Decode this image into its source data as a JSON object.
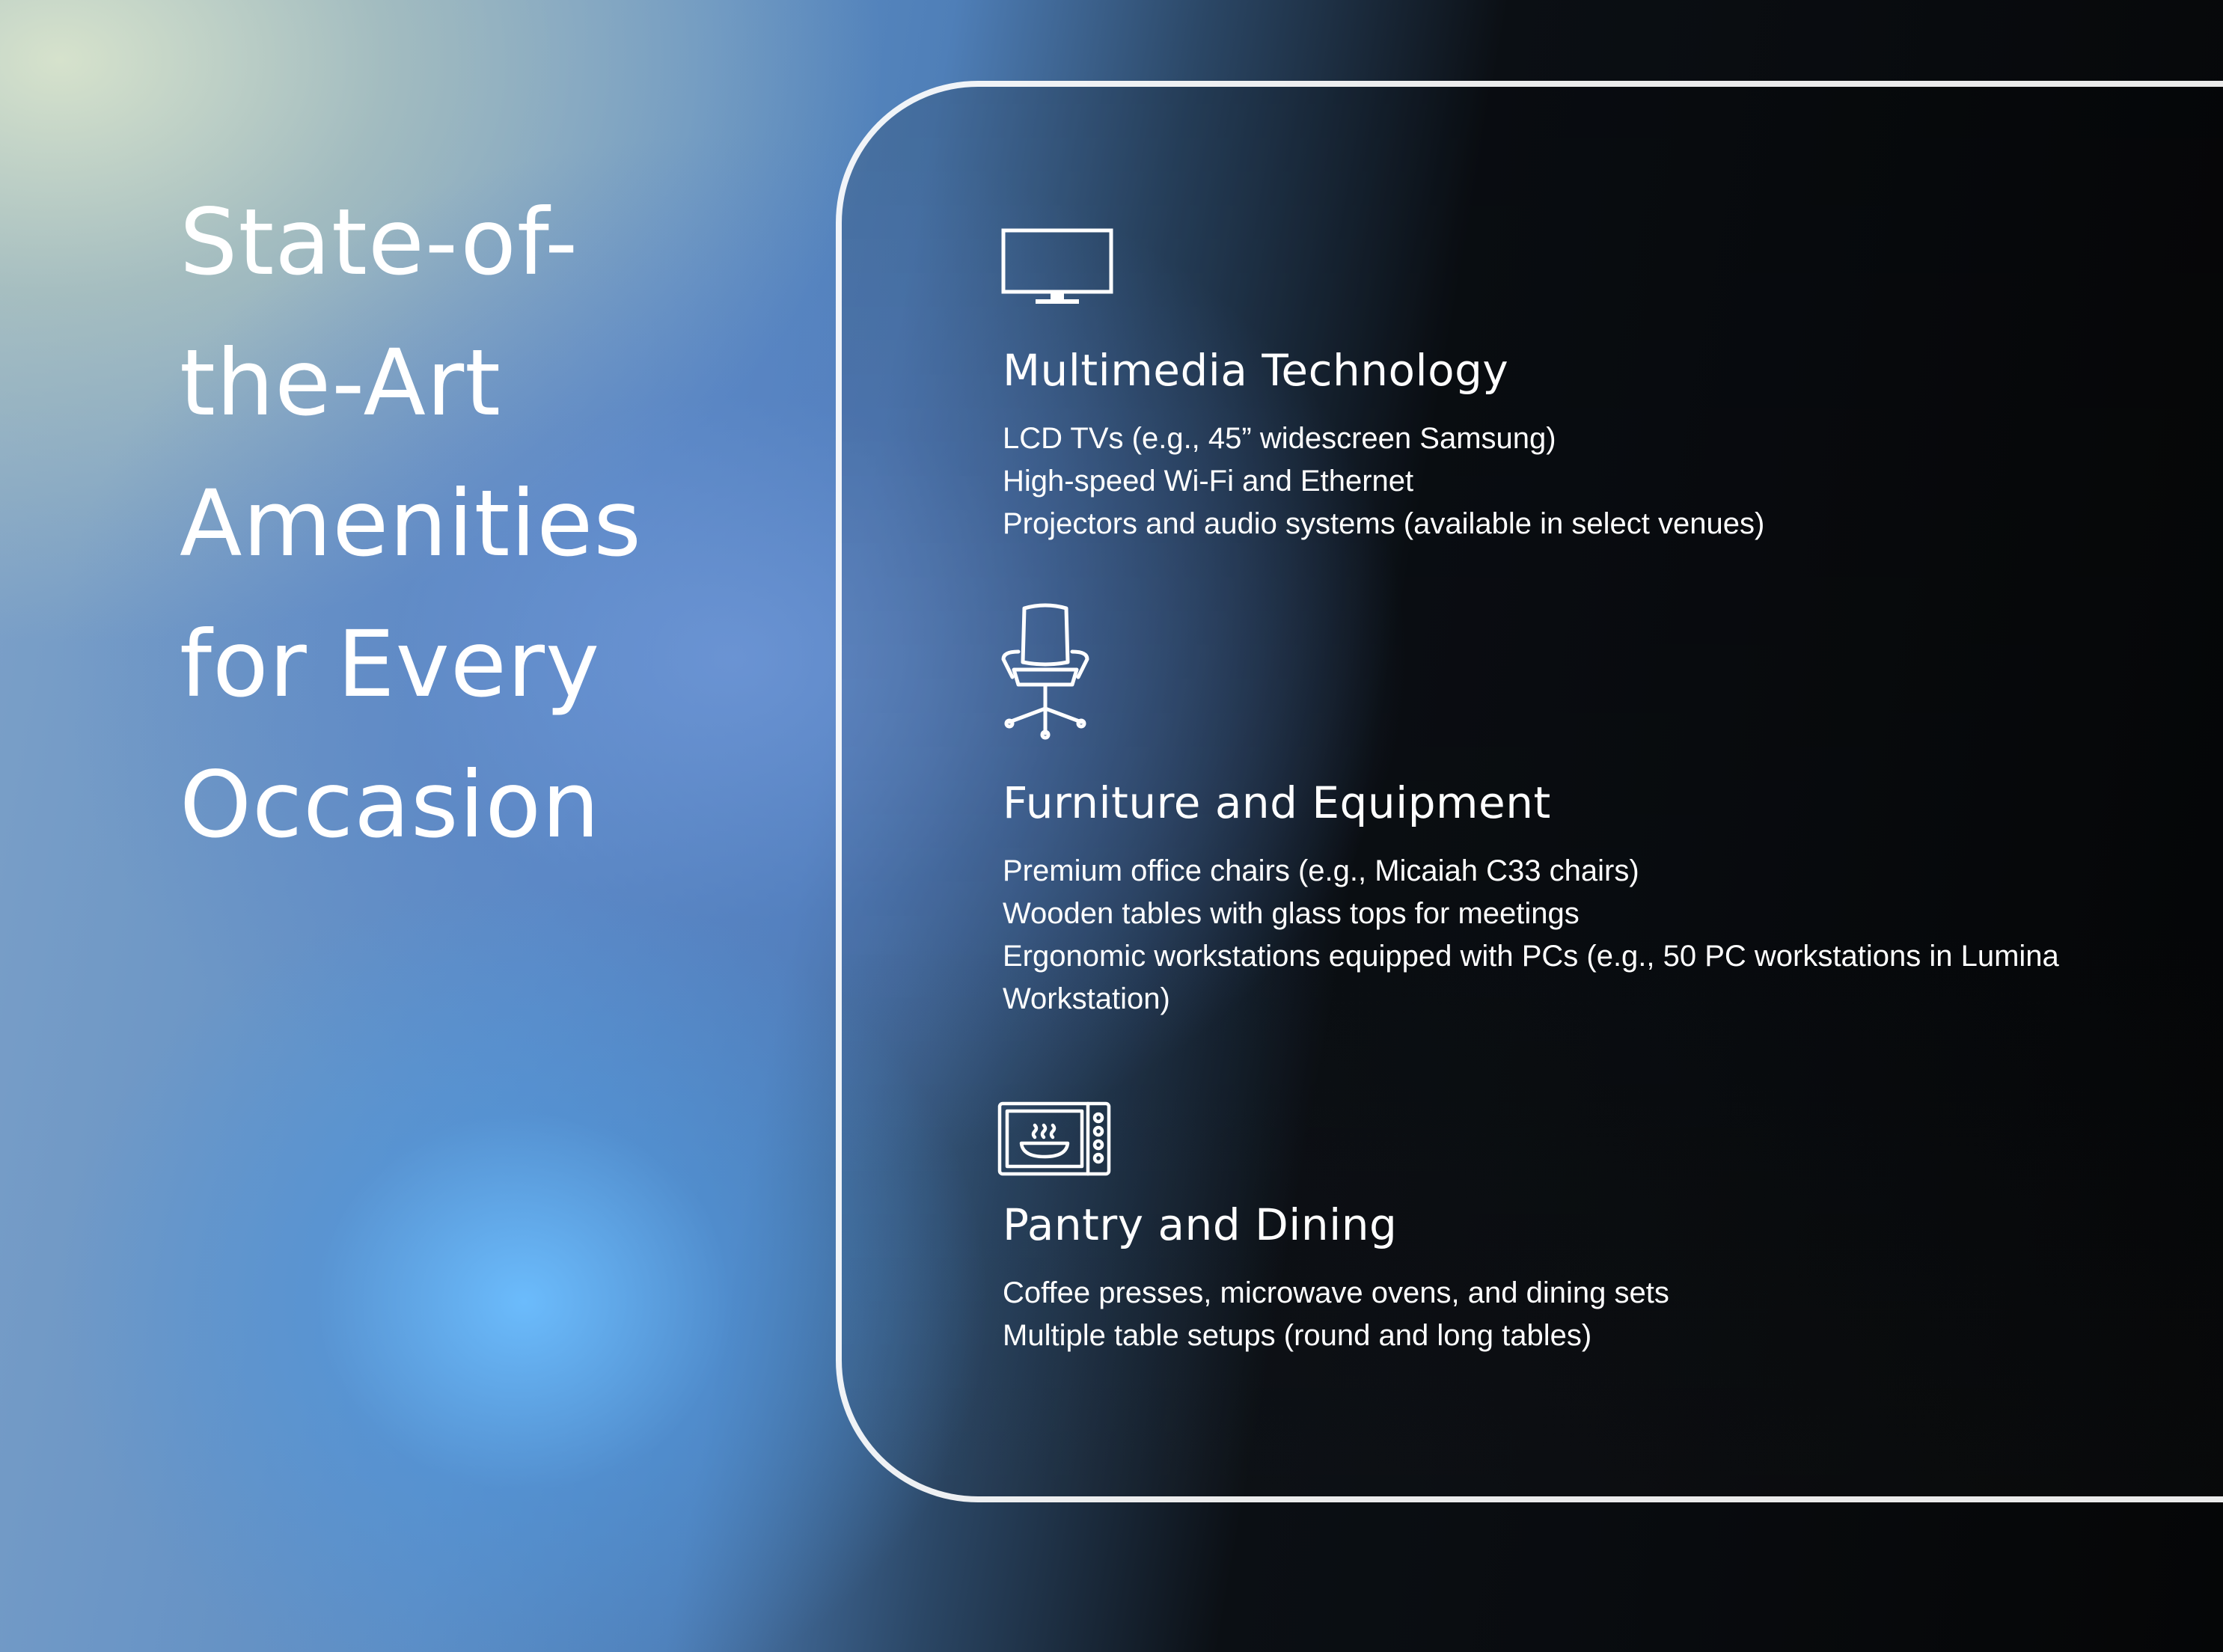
{
  "headline": "State-of-the-Art Amenities for Every Occasion",
  "sections": [
    {
      "title": "Multimedia Technology",
      "icon": "tv-icon",
      "items": [
        "LCD TVs (e.g., 45” widescreen Samsung)",
        "High-speed Wi-Fi and Ethernet",
        "Projectors and audio systems (available in select venues)"
      ]
    },
    {
      "title": "Furniture and Equipment",
      "icon": "office-chair-icon",
      "items": [
        "Premium office chairs (e.g., Micaiah C33 chairs)",
        "Wooden tables with glass tops for meetings",
        "Ergonomic workstations equipped with PCs (e.g., 50 PC workstations in Lumina Workstation)"
      ]
    },
    {
      "title": "Pantry and Dining",
      "icon": "microwave-icon",
      "items": [
        "Coffee presses, microwave ovens, and dining sets",
        "Multiple table setups (round and long tables)"
      ]
    }
  ]
}
